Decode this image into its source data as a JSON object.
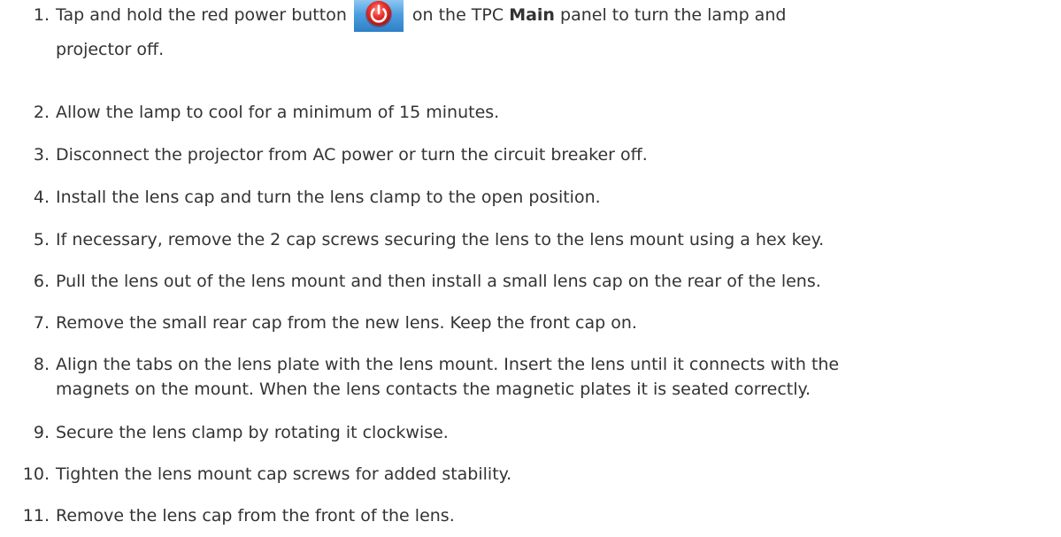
{
  "steps": [
    {
      "number": "1.",
      "text_before_icon": "Tap and hold the red power button",
      "icon": "power-button-icon",
      "text_after_icon": "on the TPC",
      "bold_text": "Main",
      "text_end": "panel to turn the lamp and",
      "continuation": "projector off."
    },
    {
      "number": "2.",
      "text": "Allow the lamp to cool for a minimum of 15 minutes."
    },
    {
      "number": "3.",
      "text": "Disconnect the projector from AC power or turn the circuit breaker off."
    },
    {
      "number": "4.",
      "text": "Install the lens cap and turn the lens clamp to the open position."
    },
    {
      "number": "5.",
      "text": "If necessary, remove the 2 cap screws securing the lens to the lens mount using a hex key."
    },
    {
      "number": "6.",
      "text": "Pull the lens out of the lens mount and then install a small lens cap on the rear of the lens."
    },
    {
      "number": "7.",
      "text": "Remove the small rear cap from the new lens. Keep the front cap on."
    },
    {
      "number": "8.",
      "text": "Align the tabs on the lens plate with the lens mount. Insert the lens until it connects with the",
      "continuation": "magnets on the mount. When the lens contacts the magnetic plates it is seated correctly."
    },
    {
      "number": "9.",
      "text": "Secure the lens clamp by rotating it clockwise."
    },
    {
      "number": "10.",
      "text": "Tighten the lens mount cap screws for added stability."
    },
    {
      "number": "11.",
      "text": "Remove the lens cap from the front of the lens."
    }
  ],
  "colors": {
    "text": "#333333",
    "icon_red": "#e02020",
    "icon_bg": "#3a8fd6"
  }
}
